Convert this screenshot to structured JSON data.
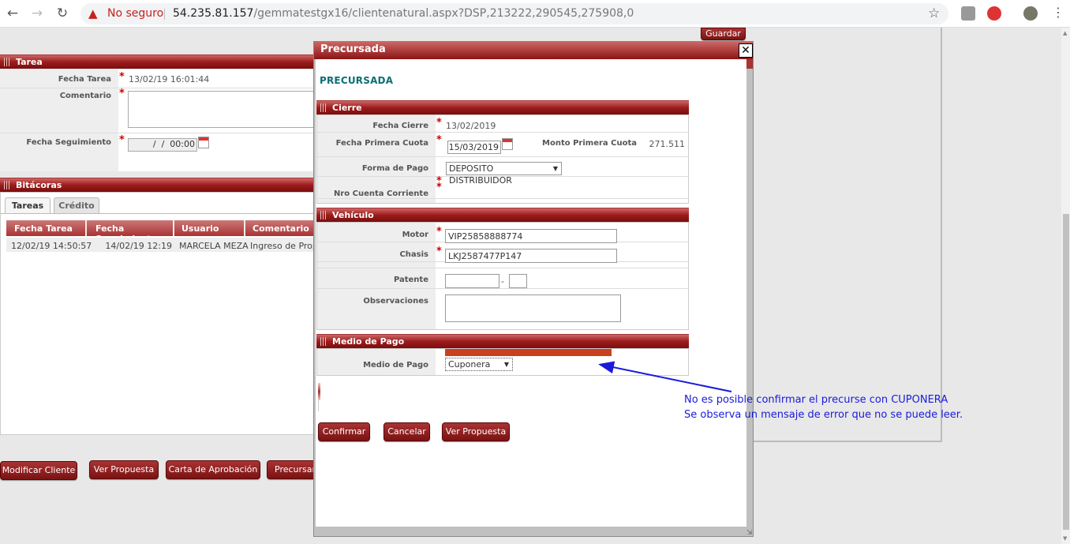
{
  "browser": {
    "security_label": "No seguro",
    "url_host": "54.235.81.157",
    "url_path": "/gemmatestgx16/clientenatural.aspx?DSP,213222,290545,275908,0"
  },
  "background": {
    "guardar_label": "Guardar",
    "tarea": {
      "title": "Tarea",
      "fecha_tarea_label": "Fecha Tarea",
      "fecha_tarea_value": "13/02/19 16:01:44",
      "comentario_label": "Comentario",
      "fecha_seguimiento_label": "Fecha Seguimiento",
      "fecha_seguimiento_value": " /  /  00:00"
    },
    "bitacoras": {
      "title": "Bitácoras",
      "tabs": [
        "Tareas",
        "Crédito"
      ],
      "columns": [
        "Fecha Tarea",
        "Fecha Seguimiento",
        "Usuario",
        "Comentario"
      ],
      "rows": [
        [
          "12/02/19 14:50:57",
          "14/02/19 12:19",
          "MARCELA MEZA",
          "Ingreso de Propu"
        ]
      ]
    },
    "buttons": [
      "Modificar Cliente",
      "Ver Propuesta",
      "Carta de Aprobación",
      "Precursar"
    ]
  },
  "modal": {
    "window_title": "Precursada",
    "heading": "PRECURSADA",
    "cierre": {
      "title": "Cierre",
      "fecha_cierre_label": "Fecha Cierre",
      "fecha_cierre_value": "13/02/2019",
      "fecha_primera_cuota_label": "Fecha Primera Cuota",
      "fecha_primera_cuota_value": "15/03/2019",
      "monto_primera_cuota_label": "Monto Primera Cuota",
      "monto_primera_cuota_value": "271.511",
      "forma_pago_label": "Forma de Pago",
      "forma_pago_value": "DEPOSITO DISTRIBUIDOR",
      "nro_cuenta_label": "Nro Cuenta Corriente"
    },
    "vehiculo": {
      "title": "Vehículo",
      "motor_label": "Motor",
      "motor_value": "VIP25858888774",
      "chasis_label": "Chasis",
      "chasis_value": "LKJ2587477P147",
      "patente_label": "Patente",
      "patente_sep": "-",
      "observaciones_label": "Observaciones"
    },
    "medio_pago": {
      "title": "Medio de Pago",
      "label": "Medio de Pago",
      "value": "Cuponera"
    },
    "buttons": {
      "confirmar": "Confirmar",
      "cancelar": "Cancelar",
      "ver_propuesta": "Ver Propuesta"
    }
  },
  "annotation": {
    "line1": "No es posible confirmar el precurse con CUPONERA",
    "line2": "Se observa un mensaje de error que no se puede leer."
  }
}
